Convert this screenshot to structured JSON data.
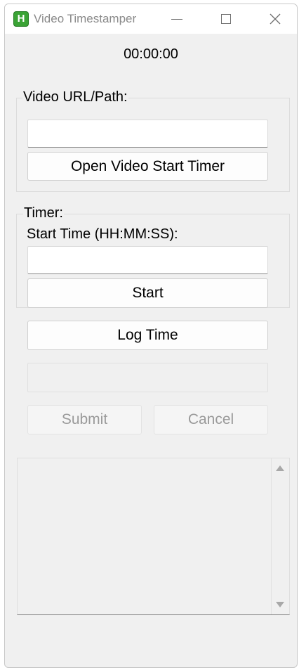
{
  "window": {
    "title": "Video Timestamper",
    "icon_letter": "H"
  },
  "timer": {
    "display": "00:00:00"
  },
  "video_group": {
    "label": "Video URL/Path:",
    "url_value": "",
    "open_button_label": "Open Video  Start Timer"
  },
  "timer_group": {
    "label": "Timer:",
    "start_time_label": "Start Time (HH:MM:SS):",
    "start_time_value": "",
    "start_button_label": "Start"
  },
  "log_button_label": "Log Time",
  "note_value": "",
  "submit_label": "Submit",
  "cancel_label": "Cancel",
  "log_text": "",
  "colors": {
    "app_icon": "#3aa335",
    "disabled_text": "#9a9a9a"
  }
}
